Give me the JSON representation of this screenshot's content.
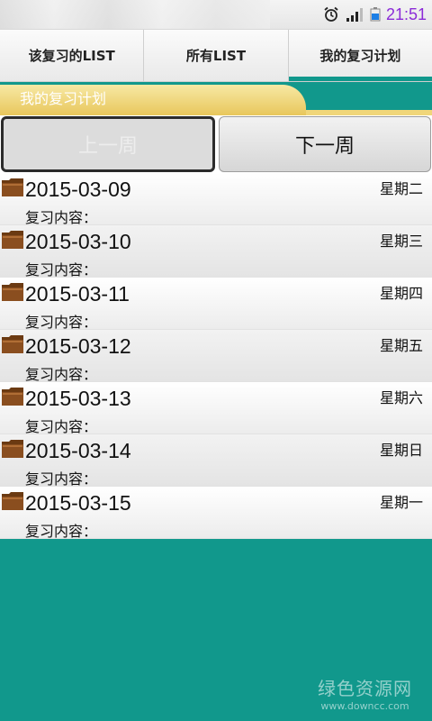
{
  "status": {
    "time": "21:51"
  },
  "tabs": [
    {
      "label": "该复习的LIST"
    },
    {
      "label": "所有LIST"
    },
    {
      "label": "我的复习计划"
    }
  ],
  "title": "我的复习计划",
  "buttons": {
    "prev": "上一周",
    "next": "下一周"
  },
  "items": [
    {
      "date": "2015-03-09",
      "weekday": "星期二",
      "content_label": "复习内容："
    },
    {
      "date": "2015-03-10",
      "weekday": "星期三",
      "content_label": "复习内容："
    },
    {
      "date": "2015-03-11",
      "weekday": "星期四",
      "content_label": "复习内容："
    },
    {
      "date": "2015-03-12",
      "weekday": "星期五",
      "content_label": "复习内容："
    },
    {
      "date": "2015-03-13",
      "weekday": "星期六",
      "content_label": "复习内容："
    },
    {
      "date": "2015-03-14",
      "weekday": "星期日",
      "content_label": "复习内容："
    },
    {
      "date": "2015-03-15",
      "weekday": "星期一",
      "content_label": "复习内容："
    }
  ],
  "watermark": {
    "title": "绿色资源网",
    "url": "www.downcc.com"
  },
  "colors": {
    "background": "#11988c",
    "title_tab": "#f0d67a",
    "clock": "#8b2bd8"
  },
  "icons": [
    "alarm-icon",
    "signal-icon",
    "battery-icon",
    "folder-icon"
  ]
}
